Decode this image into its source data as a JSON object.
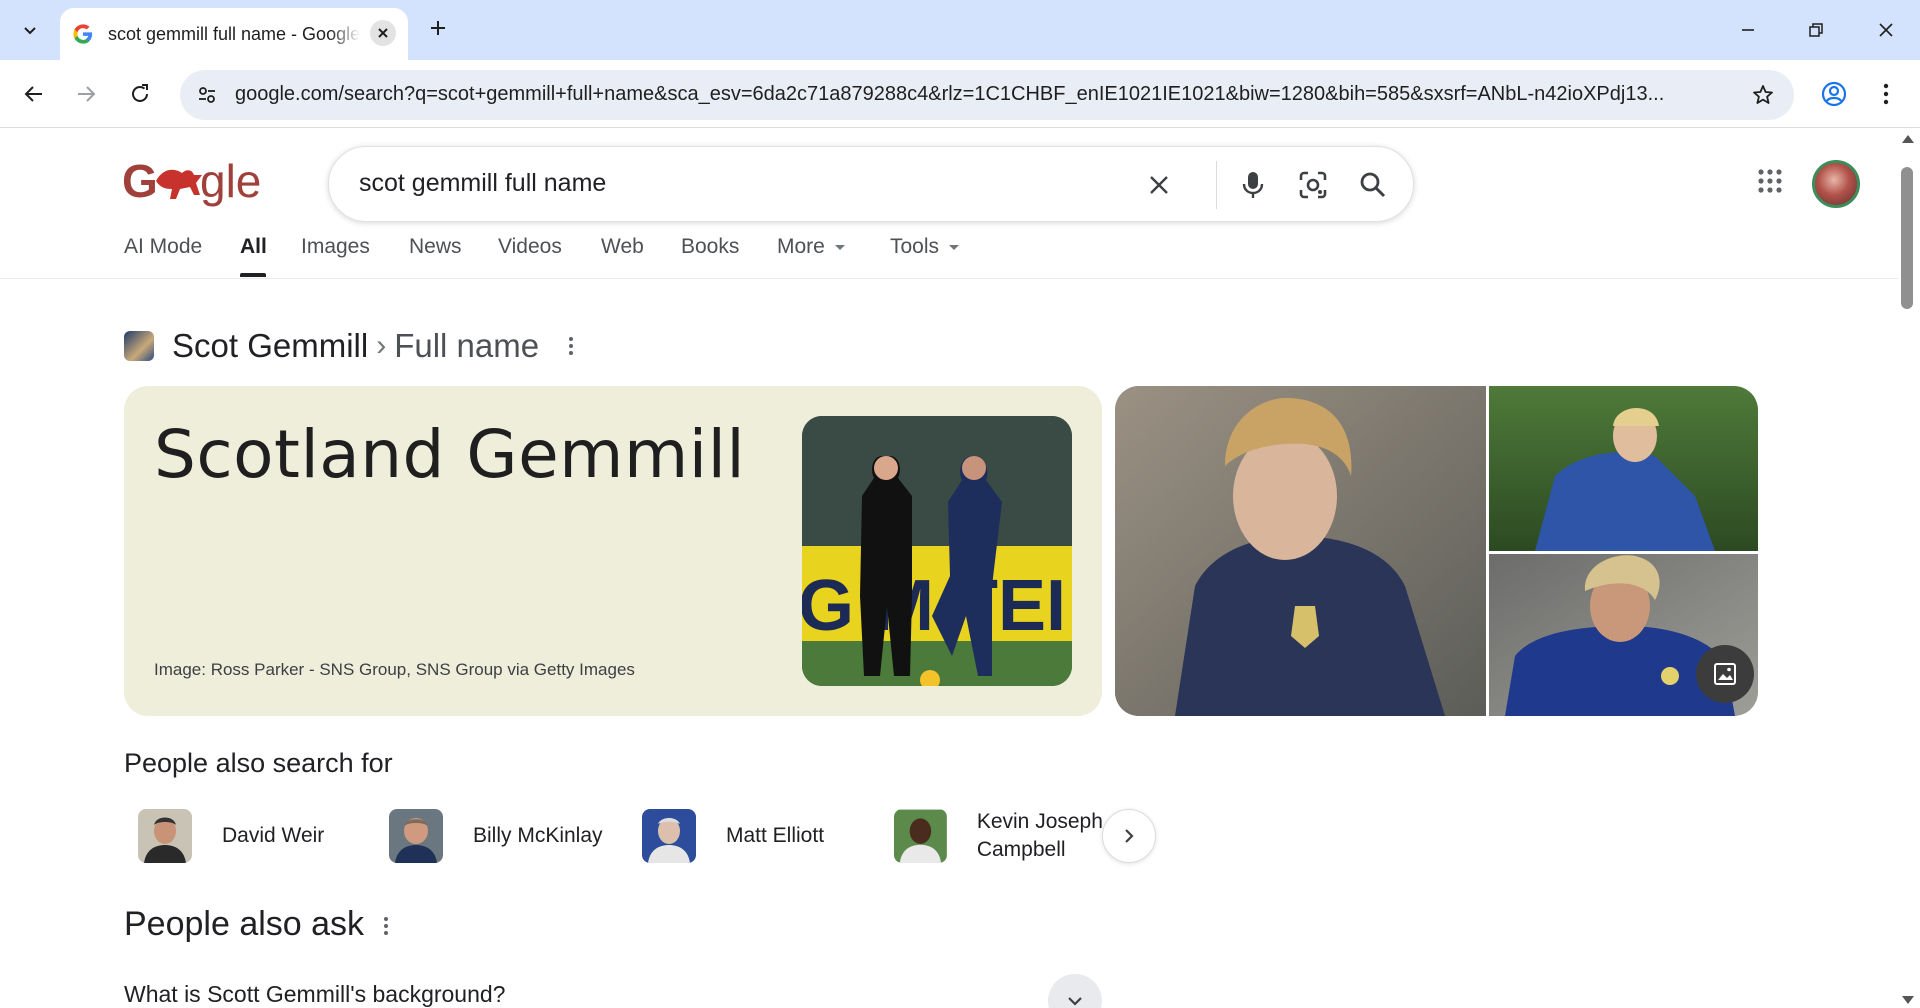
{
  "browser": {
    "tab_title": "scot gemmill full name - Google Search",
    "url": "google.com/search?q=scot+gemmill+full+name&sca_esv=6da2c71a879288c4&rlz=1C1CHBF_enIE1021IE1021&biw=1280&bih=585&sxsrf=ANbL-n42ioXPdj13..."
  },
  "search": {
    "query": "scot gemmill full name"
  },
  "nav": {
    "tabs": [
      {
        "label": "AI Mode"
      },
      {
        "label": "All"
      },
      {
        "label": "Images"
      },
      {
        "label": "News"
      },
      {
        "label": "Videos"
      },
      {
        "label": "Web"
      },
      {
        "label": "Books"
      },
      {
        "label": "More"
      },
      {
        "label": "Tools"
      }
    ],
    "active_tab": "All"
  },
  "knowledge": {
    "entity": "Scot Gemmill",
    "separator": "›",
    "attribute": "Full name",
    "answer": "Scotland Gemmill",
    "image_credit": "Image: Ross Parker - SNS Group, SNS Group via Getty Images"
  },
  "people_also_search": {
    "title": "People also search for",
    "people": [
      {
        "name": "David Weir"
      },
      {
        "name": "Billy McKinlay"
      },
      {
        "name": "Matt Elliott"
      },
      {
        "name": "Kevin Joseph Campbell"
      }
    ]
  },
  "people_also_ask": {
    "title": "People also ask",
    "questions": [
      {
        "q": "What is Scott Gemmill's background?"
      }
    ]
  },
  "colors": {
    "accent_blue": "#1a73e8",
    "tab_strip": "#d3e3fd",
    "answer_card_bg": "#efeedb",
    "omnibox_bg": "#e9eef6"
  },
  "icons": {
    "tab_favicon": "google-g-icon",
    "search_clear": "close-icon",
    "voice": "microphone-icon",
    "lens": "camera-lens-icon",
    "search": "search-icon",
    "apps": "apps-grid-icon"
  }
}
